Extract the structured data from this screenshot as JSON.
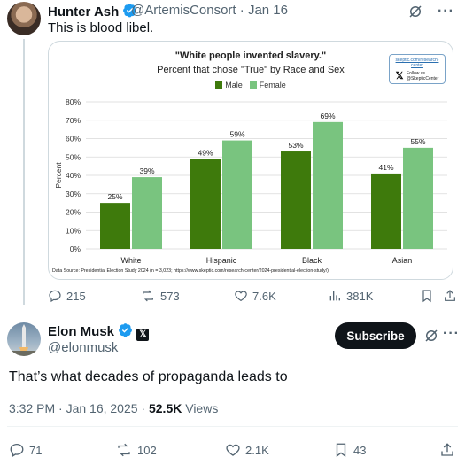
{
  "quoted_tweet": {
    "author_name": "Hunter Ash",
    "handle": "@ArtemisConsort",
    "date": "Jan 16",
    "text": "This is blood libel.",
    "stats": {
      "replies": "215",
      "reposts": "573",
      "likes": "7.6K",
      "views": "381K"
    }
  },
  "chart_image": {
    "badge_url": "skeptic.com/research-center",
    "badge_follow": "Follow us",
    "badge_handle": "@SkepticCenter",
    "source": "Data Source: Presidential Election Study 2024 (n = 3,023; https://www.skeptic.com/research-center/2024-presidential-election-study/)."
  },
  "chart_data": {
    "type": "bar",
    "title": "\"White people invented slavery.\"",
    "subtitle": "Percent that chose \"True\" by Race and Sex",
    "xlabel": "",
    "ylabel": "Percent",
    "categories": [
      "White",
      "Hispanic",
      "Black",
      "Asian"
    ],
    "series": [
      {
        "name": "Male",
        "values": [
          25,
          49,
          53,
          41
        ],
        "labels": [
          "25%",
          "49%",
          "53%",
          "41%"
        ]
      },
      {
        "name": "Female",
        "values": [
          39,
          59,
          69,
          55
        ],
        "labels": [
          "39%",
          "59%",
          "69%",
          "55%"
        ]
      }
    ],
    "ylim": [
      0,
      80
    ],
    "yticks": [
      "0%",
      "10%",
      "20%",
      "30%",
      "40%",
      "50%",
      "60%",
      "70%",
      "80%"
    ],
    "colors": {
      "Male": "#3e7a0c",
      "Female": "#79c47f"
    },
    "grid": true,
    "legend": "top-center"
  },
  "main_tweet": {
    "author_name": "Elon Musk",
    "handle": "@elonmusk",
    "subscribe_label": "Subscribe",
    "text": "That’s what decades of propaganda leads to",
    "time": "3:32 PM · Jan 16, 2025 · ",
    "views_count": "52.5K",
    "views_label": " Views",
    "stats": {
      "replies": "71",
      "reposts": "102",
      "likes": "2.1K",
      "bookmarks": "43"
    }
  },
  "colors": {
    "verified": "#1d9bf0",
    "text_secondary": "#536471",
    "subscribe_bg": "#0f1419"
  },
  "icons": [
    "verified-badge-icon",
    "grok-icon",
    "more-icon",
    "reply-icon",
    "repost-icon",
    "like-icon",
    "views-icon",
    "bookmark-icon",
    "share-icon",
    "x-logo-icon"
  ]
}
